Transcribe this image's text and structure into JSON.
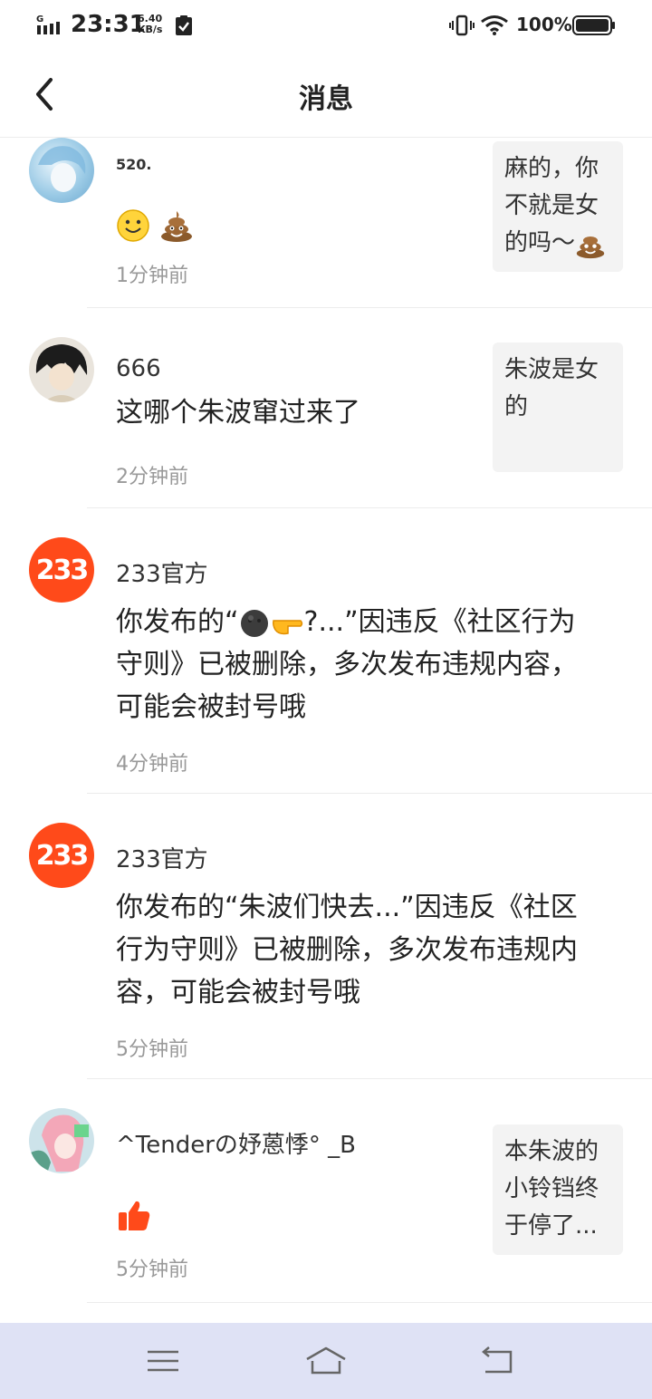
{
  "status_bar": {
    "network": "G",
    "time": "23:31",
    "speed_value": "6.40",
    "speed_unit": "KB/s",
    "battery": "100%"
  },
  "header": {
    "title": "消息",
    "back_icon": "chevron-left-icon"
  },
  "messages": [
    {
      "name": "520.",
      "content": "",
      "content_emojis": [
        "smile-emoji",
        "poop-emoji"
      ],
      "time": "1分钟前",
      "quote": "麻的，你不就是女的吗～",
      "quote_emoji": "poop-emoji"
    },
    {
      "name": "666",
      "content": "这哪个朱波窜过来了",
      "time": "2分钟前",
      "quote": "朱波是女的"
    },
    {
      "name": "233官方",
      "avatar_text": "233",
      "content_prefix": "你发布的“",
      "content_emojis": [
        "dark-face-emoji",
        "pointing-hand-emoji"
      ],
      "content_suffix": "?...”因违反《社区行为守则》已被删除，多次发布违规内容，可能会被封号哦",
      "time": "4分钟前"
    },
    {
      "name": "233官方",
      "avatar_text": "233",
      "content": "你发布的“朱波们快去...”因违反《社区行为守则》已被删除，多次发布违规内容，可能会被封号哦",
      "time": "5分钟前"
    },
    {
      "name": "^Tenderの妤蒽悸° _B",
      "content": "",
      "content_emojis": [
        "thumbs-up-icon"
      ],
      "time": "5分钟前",
      "quote": "本朱波的小铃铛终于停了..."
    }
  ],
  "nav_bar": {
    "items": [
      "menu-icon",
      "home-icon",
      "back-icon"
    ]
  },
  "colors": {
    "brand_orange": "#ff4a1a",
    "nav_background": "#dfe2f5",
    "quote_background": "#f3f3f3",
    "time_text": "#999999"
  }
}
